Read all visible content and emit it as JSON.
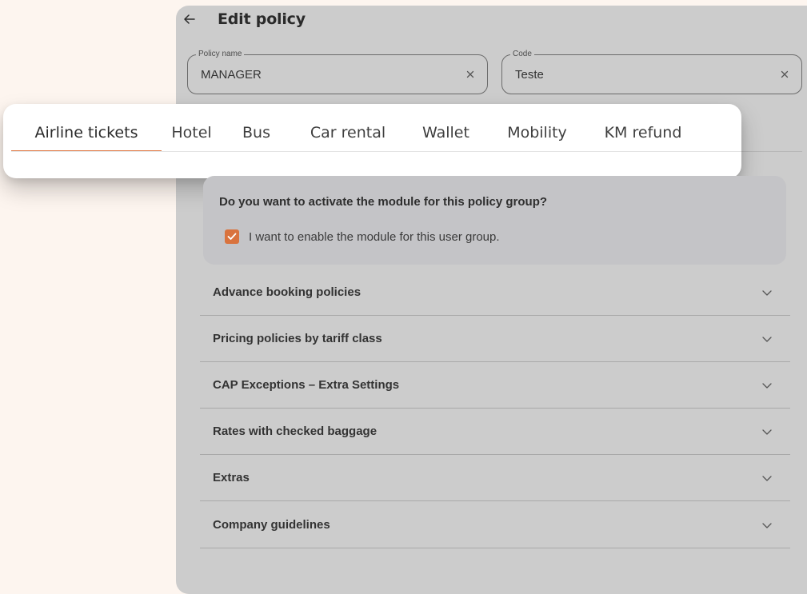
{
  "header": {
    "title": "Edit policy",
    "back_icon": "arrow-left-icon"
  },
  "fields": {
    "policy_name": {
      "label": "Policy name",
      "value": "MANAGER"
    },
    "code": {
      "label": "Code",
      "value": "Teste"
    }
  },
  "tabs": [
    {
      "label": "Airline tickets",
      "active": true
    },
    {
      "label": "Hotel"
    },
    {
      "label": "Bus"
    },
    {
      "label": "Car rental"
    },
    {
      "label": "Wallet"
    },
    {
      "label": "Mobility"
    },
    {
      "label": "KM refund"
    }
  ],
  "module": {
    "question": "Do you want to activate the module for this policy group?",
    "enable_label": "I want to enable the module for this user group.",
    "enabled": true
  },
  "accordions": [
    {
      "label": "Advance booking policies"
    },
    {
      "label": "Pricing policies by tariff class"
    },
    {
      "label": "CAP Exceptions – Extra Settings"
    },
    {
      "label": "Rates with checked baggage"
    },
    {
      "label": "Extras"
    },
    {
      "label": "Company guidelines"
    }
  ],
  "colors": {
    "accent": "#e07a46",
    "checkbox": "#d9733e",
    "panel": "#cccccc",
    "page_background": "#fdf5ef"
  }
}
